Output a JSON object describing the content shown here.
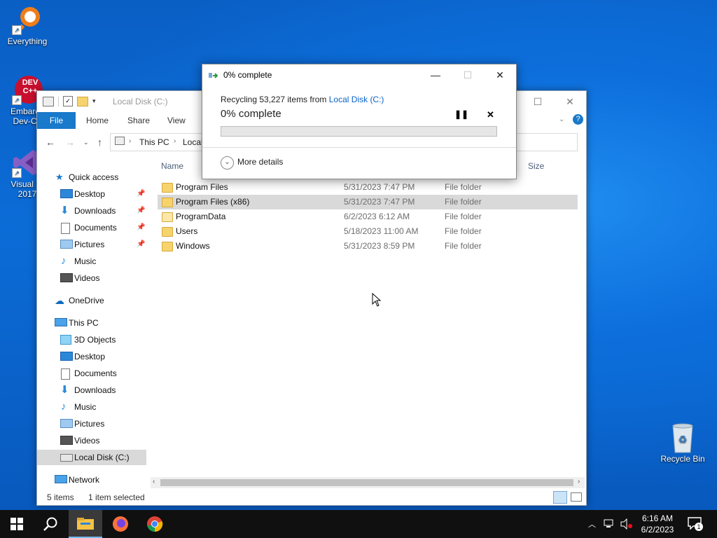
{
  "desktop": {
    "icons": [
      {
        "label": "Everything"
      },
      {
        "label_line1": "Embarca",
        "label_line2": "Dev-C+",
        "badge": "DEV C++"
      },
      {
        "label_line1": "Visual St",
        "label_line2": "2017"
      },
      {
        "label": "Recycle Bin"
      }
    ]
  },
  "explorer": {
    "title": "Local Disk (C:)",
    "ribbon_tabs": [
      "File",
      "Home",
      "Share",
      "View"
    ],
    "address": [
      "This PC",
      "Local"
    ],
    "columns": {
      "name": "Name",
      "size": "Size"
    },
    "nav": {
      "quick_access": "Quick access",
      "quick_items": [
        "Desktop",
        "Downloads",
        "Documents",
        "Pictures",
        "Music",
        "Videos"
      ],
      "onedrive": "OneDrive",
      "this_pc": "This PC",
      "pc_items": [
        "3D Objects",
        "Desktop",
        "Documents",
        "Downloads",
        "Music",
        "Pictures",
        "Videos",
        "Local Disk (C:)"
      ],
      "network": "Network"
    },
    "files": [
      {
        "name": "Program Files",
        "date": "5/31/2023 7:47 PM",
        "type": "File folder"
      },
      {
        "name": "Program Files (x86)",
        "date": "5/31/2023 7:47 PM",
        "type": "File folder"
      },
      {
        "name": "ProgramData",
        "date": "6/2/2023 6:12 AM",
        "type": "File folder"
      },
      {
        "name": "Users",
        "date": "5/18/2023 11:00 AM",
        "type": "File folder"
      },
      {
        "name": "Windows",
        "date": "5/31/2023 8:59 PM",
        "type": "File folder"
      }
    ],
    "status": {
      "items": "5 items",
      "selected": "1 item selected"
    }
  },
  "progress_dialog": {
    "title": "0% complete",
    "line_prefix": "Recycling 53,227 items from",
    "line_link": "Local Disk (C:)",
    "percent_text": "0% complete",
    "progress": 0.0,
    "more_details": "More details"
  },
  "taskbar": {
    "time": "6:16 AM",
    "date": "6/2/2023",
    "notification_count": "1"
  },
  "colors": {
    "accent": "#1979ca",
    "progress_green": "#06b025",
    "link": "#0b62c4"
  }
}
